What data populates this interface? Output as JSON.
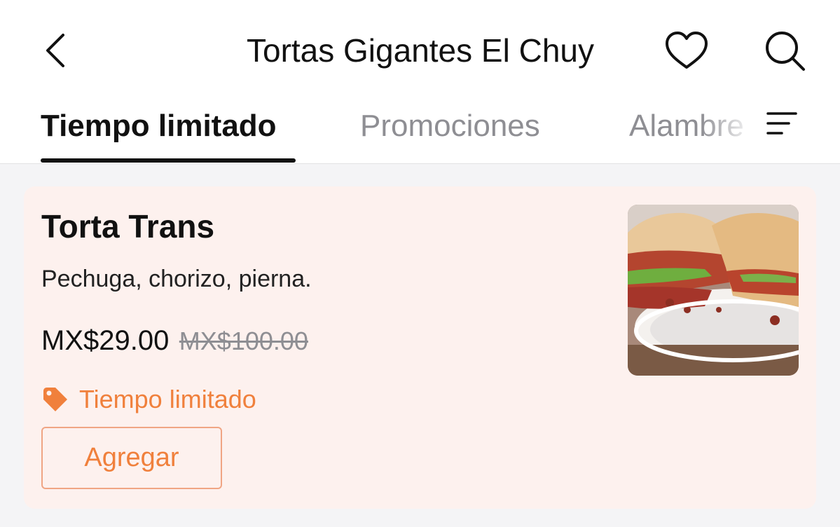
{
  "header": {
    "title": "Tortas Gigantes El Chuy",
    "back_icon": "chevron-left-icon",
    "favorite_icon": "heart-icon",
    "search_icon": "search-icon"
  },
  "tabs": [
    {
      "label": "Tiempo limitado",
      "active": true
    },
    {
      "label": "Promociones",
      "active": false
    },
    {
      "label": "Alambre",
      "active": false
    }
  ],
  "tab_menu_icon": "menu-lines-icon",
  "item": {
    "name": "Torta Trans",
    "description": "Pechuga, chorizo, pierna.",
    "price": "MX$29.00",
    "original_price": "MX$100.00",
    "promo_label": "Tiempo limitado",
    "promo_icon": "tag-icon",
    "add_label": "Agregar",
    "image": "torta-sandwich-photo"
  },
  "colors": {
    "accent": "#f0803c",
    "card_background": "#fdf1ee",
    "page_background": "#f4f4f6",
    "inactive_tab": "#8e8e93"
  }
}
